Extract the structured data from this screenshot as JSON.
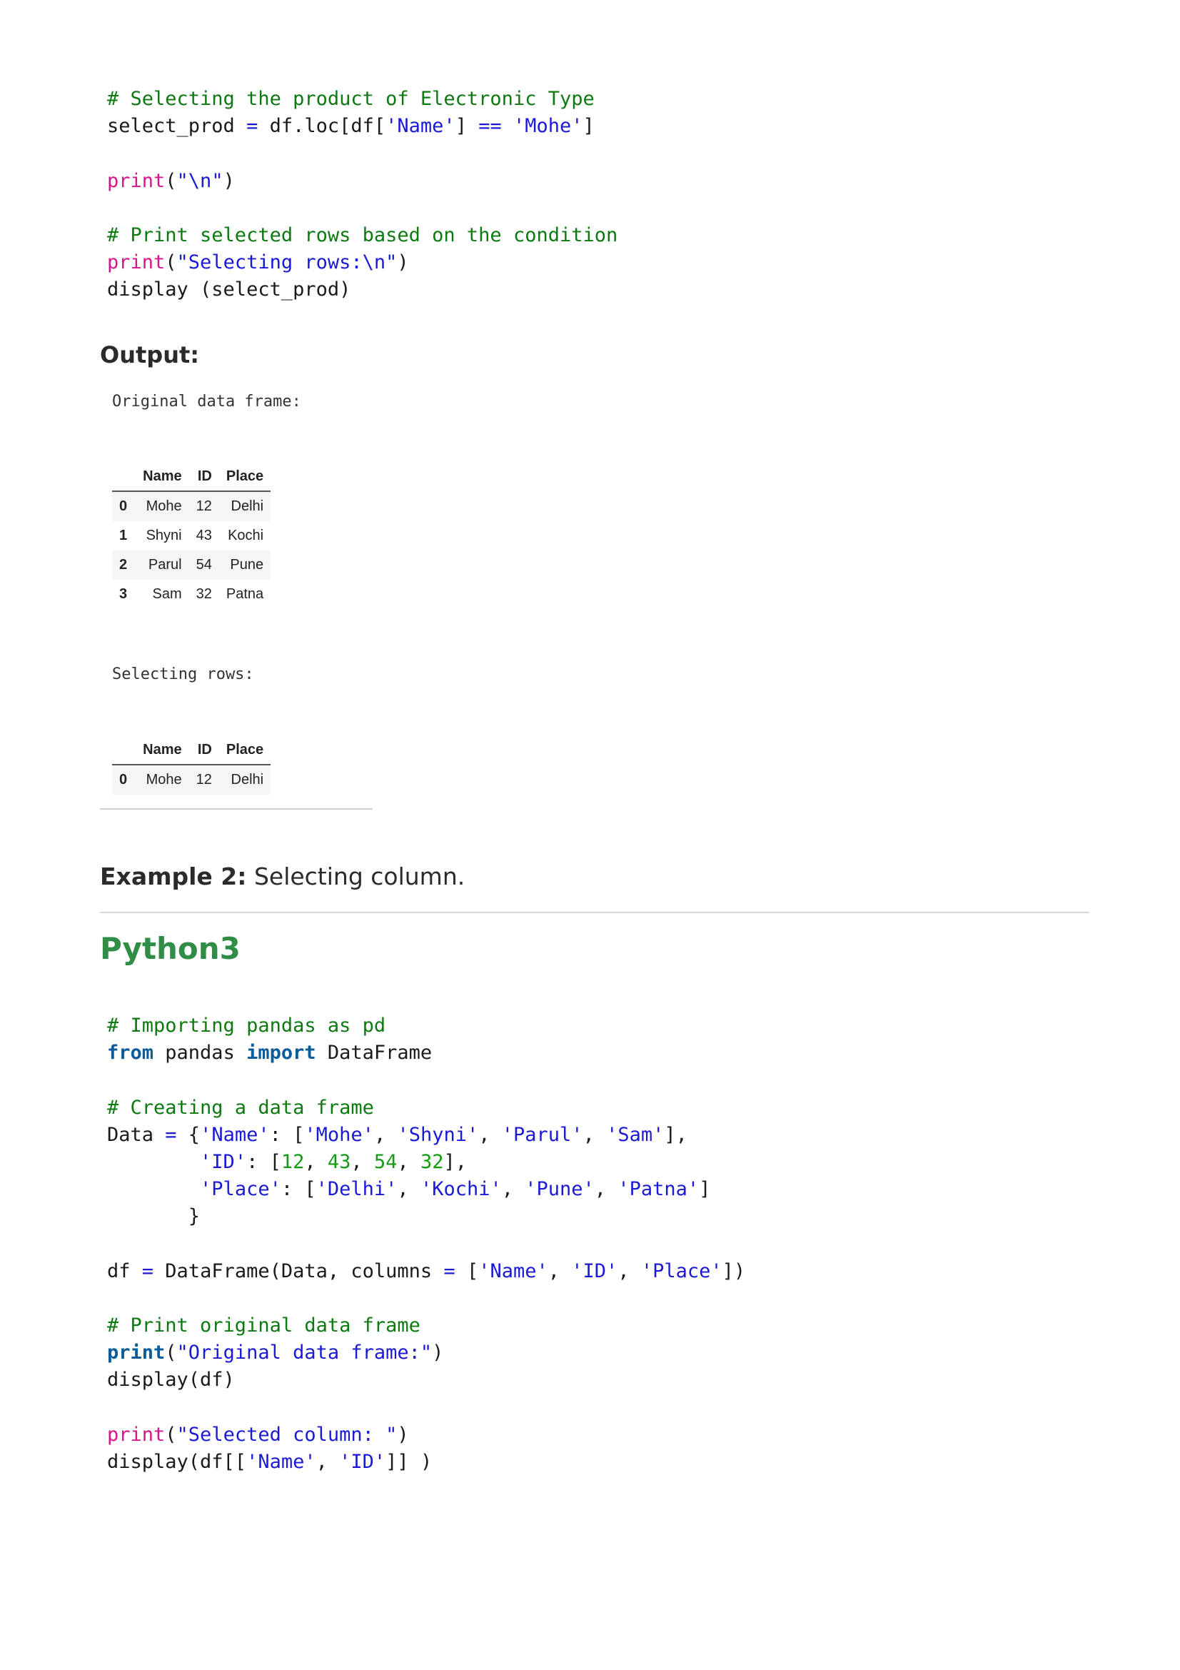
{
  "code_block_1": {
    "lines": [
      [
        {
          "t": "# Selecting the product of Electronic Type",
          "c": "c"
        }
      ],
      [
        {
          "t": "select_prod ",
          "c": ""
        },
        {
          "t": "=",
          "c": "o"
        },
        {
          "t": " df.loc[df[",
          "c": ""
        },
        {
          "t": "'Name'",
          "c": "s"
        },
        {
          "t": "] ",
          "c": ""
        },
        {
          "t": "==",
          "c": "o"
        },
        {
          "t": " ",
          "c": ""
        },
        {
          "t": "'Mohe'",
          "c": "s"
        },
        {
          "t": "]",
          "c": ""
        }
      ],
      [],
      [
        {
          "t": "print",
          "c": "p"
        },
        {
          "t": "(",
          "c": ""
        },
        {
          "t": "\"\\n\"",
          "c": "s"
        },
        {
          "t": ")",
          "c": ""
        }
      ],
      [],
      [
        {
          "t": "# Print selected rows based on the condition",
          "c": "c"
        }
      ],
      [
        {
          "t": "print",
          "c": "p"
        },
        {
          "t": "(",
          "c": ""
        },
        {
          "t": "\"Selecting rows:\\n\"",
          "c": "s"
        },
        {
          "t": ")",
          "c": ""
        }
      ],
      [
        {
          "t": "display (select_prod)",
          "c": ""
        }
      ]
    ]
  },
  "output_label": "Output:",
  "output": {
    "original_label": "Original data frame:",
    "selecting_label": "Selecting rows:",
    "columns": [
      "Name",
      "ID",
      "Place"
    ],
    "original_rows": [
      {
        "index": "0",
        "cells": [
          "Mohe",
          "12",
          "Delhi"
        ]
      },
      {
        "index": "1",
        "cells": [
          "Shyni",
          "43",
          "Kochi"
        ]
      },
      {
        "index": "2",
        "cells": [
          "Parul",
          "54",
          "Pune"
        ]
      },
      {
        "index": "3",
        "cells": [
          "Sam",
          "32",
          "Patna"
        ]
      }
    ],
    "selected_rows": [
      {
        "index": "0",
        "cells": [
          "Mohe",
          "12",
          "Delhi"
        ]
      }
    ]
  },
  "example": {
    "label": "Example 2:",
    "text": " Selecting column."
  },
  "language_heading": "Python3",
  "code_block_2": {
    "lines": [
      [
        {
          "t": "# Importing pandas as pd",
          "c": "c"
        }
      ],
      [
        {
          "t": "from",
          "c": "k"
        },
        {
          "t": " pandas ",
          "c": ""
        },
        {
          "t": "import",
          "c": "k"
        },
        {
          "t": " DataFrame",
          "c": ""
        }
      ],
      [],
      [
        {
          "t": "# Creating a data frame",
          "c": "c"
        }
      ],
      [
        {
          "t": "Data ",
          "c": ""
        },
        {
          "t": "=",
          "c": "o"
        },
        {
          "t": " {",
          "c": ""
        },
        {
          "t": "'Name'",
          "c": "s"
        },
        {
          "t": ": [",
          "c": ""
        },
        {
          "t": "'Mohe'",
          "c": "s"
        },
        {
          "t": ", ",
          "c": ""
        },
        {
          "t": "'Shyni'",
          "c": "s"
        },
        {
          "t": ", ",
          "c": ""
        },
        {
          "t": "'Parul'",
          "c": "s"
        },
        {
          "t": ", ",
          "c": ""
        },
        {
          "t": "'Sam'",
          "c": "s"
        },
        {
          "t": "],",
          "c": ""
        }
      ],
      [
        {
          "t": "        ",
          "c": ""
        },
        {
          "t": "'ID'",
          "c": "s"
        },
        {
          "t": ": [",
          "c": ""
        },
        {
          "t": "12",
          "c": "n"
        },
        {
          "t": ", ",
          "c": ""
        },
        {
          "t": "43",
          "c": "n"
        },
        {
          "t": ", ",
          "c": ""
        },
        {
          "t": "54",
          "c": "n"
        },
        {
          "t": ", ",
          "c": ""
        },
        {
          "t": "32",
          "c": "n"
        },
        {
          "t": "],",
          "c": ""
        }
      ],
      [
        {
          "t": "        ",
          "c": ""
        },
        {
          "t": "'Place'",
          "c": "s"
        },
        {
          "t": ": [",
          "c": ""
        },
        {
          "t": "'Delhi'",
          "c": "s"
        },
        {
          "t": ", ",
          "c": ""
        },
        {
          "t": "'Kochi'",
          "c": "s"
        },
        {
          "t": ", ",
          "c": ""
        },
        {
          "t": "'Pune'",
          "c": "s"
        },
        {
          "t": ", ",
          "c": ""
        },
        {
          "t": "'Patna'",
          "c": "s"
        },
        {
          "t": "]",
          "c": ""
        }
      ],
      [
        {
          "t": "       }",
          "c": ""
        }
      ],
      [],
      [
        {
          "t": "df ",
          "c": ""
        },
        {
          "t": "=",
          "c": "o"
        },
        {
          "t": " DataFrame(Data, columns ",
          "c": ""
        },
        {
          "t": "=",
          "c": "o"
        },
        {
          "t": " [",
          "c": ""
        },
        {
          "t": "'Name'",
          "c": "s"
        },
        {
          "t": ", ",
          "c": ""
        },
        {
          "t": "'ID'",
          "c": "s"
        },
        {
          "t": ", ",
          "c": ""
        },
        {
          "t": "'Place'",
          "c": "s"
        },
        {
          "t": "])",
          "c": ""
        }
      ],
      [],
      [
        {
          "t": "# Print original data frame",
          "c": "c"
        }
      ],
      [
        {
          "t": "print",
          "c": "pb"
        },
        {
          "t": "(",
          "c": ""
        },
        {
          "t": "\"Original data frame:\"",
          "c": "s"
        },
        {
          "t": ")",
          "c": ""
        }
      ],
      [
        {
          "t": "display(df)",
          "c": ""
        }
      ],
      [],
      [
        {
          "t": "print",
          "c": "p"
        },
        {
          "t": "(",
          "c": ""
        },
        {
          "t": "\"Selected column: \"",
          "c": "s"
        },
        {
          "t": ")",
          "c": ""
        }
      ],
      [
        {
          "t": "display(df[[",
          "c": ""
        },
        {
          "t": "'Name'",
          "c": "s"
        },
        {
          "t": ", ",
          "c": ""
        },
        {
          "t": "'ID'",
          "c": "s"
        },
        {
          "t": "]] )",
          "c": ""
        }
      ]
    ]
  }
}
